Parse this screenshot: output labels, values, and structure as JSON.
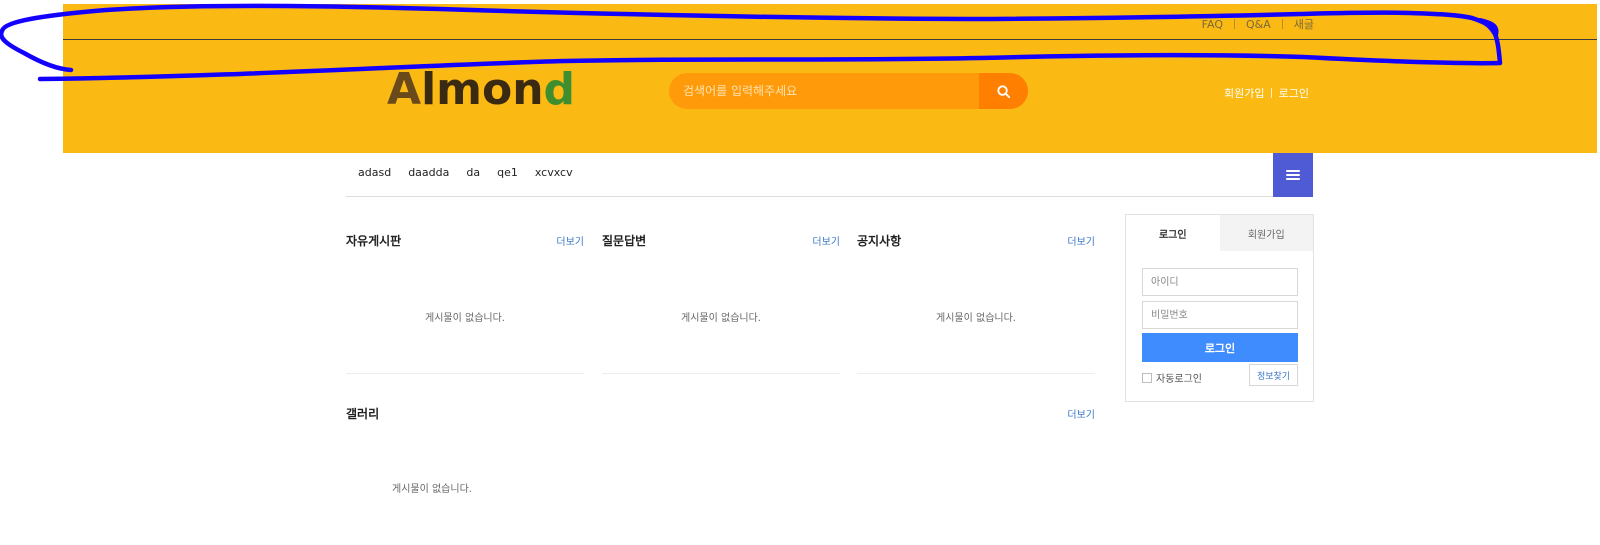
{
  "header": {
    "top_links": [
      "FAQ",
      "Q&A",
      "새글"
    ],
    "logo": {
      "first": "A",
      "middle": "lmon",
      "last": "d"
    },
    "search": {
      "placeholder": "검색어를 입력해주세요"
    },
    "auth": {
      "signup_label": "회원가입",
      "login_label": "로그인"
    }
  },
  "navigation": {
    "categories": [
      "adasd",
      "daadda",
      "da",
      "qe1",
      "xcvxcv"
    ]
  },
  "boards": {
    "free": {
      "title": "자유게시판",
      "more": "더보기",
      "empty": "게시물이 없습니다."
    },
    "qa": {
      "title": "질문답변",
      "more": "더보기",
      "empty": "게시물이 없습니다."
    },
    "notice": {
      "title": "공지사항",
      "more": "더보기",
      "empty": "게시물이 없습니다."
    },
    "gallery": {
      "title": "갤러리",
      "more": "더보기",
      "empty": "게시물이 없습니다."
    }
  },
  "login_box": {
    "tabs": [
      "로그인",
      "회원가입"
    ],
    "id_placeholder": "아이디",
    "password_placeholder": "비밀번호",
    "submit_label": "로그인",
    "auto_login_label": "자동로그인",
    "find_info_label": "정보찾기"
  },
  "icons": {
    "search": "search-icon",
    "menu": "hamburger-icon",
    "checkbox": "checkbox-icon"
  },
  "colors": {
    "header_background": "#fbb913",
    "search_background": "#ff9a0a",
    "search_button": "#ff7f00",
    "menu_button": "#4f5bd5",
    "login_button": "#3f8cff",
    "annotation_stroke": "#1400ff"
  }
}
